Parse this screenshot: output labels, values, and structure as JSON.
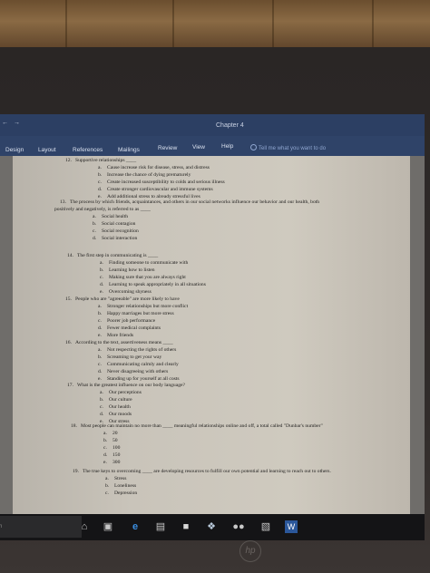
{
  "window": {
    "title": "Chapter 4",
    "quick_access": "← →"
  },
  "ribbon": {
    "tabs": [
      "Design",
      "Layout",
      "References",
      "Mailings",
      "Review",
      "View",
      "Help"
    ],
    "tell_me": "Tell me what you want to do"
  },
  "document": {
    "questions": [
      {
        "number": "12.",
        "text": "Supportive relationships ____",
        "options": [
          {
            "letter": "a.",
            "text": "Cause increase risk for disease, stress, and distress"
          },
          {
            "letter": "b.",
            "text": "Increase the chance of dying prematurely"
          },
          {
            "letter": "c.",
            "text": "Create increased susceptibility to colds and serious illness"
          },
          {
            "letter": "d.",
            "text": "Create stronger cardiovascular and immune systems"
          },
          {
            "letter": "e.",
            "text": "Add additional stress to already stressful lives"
          }
        ]
      },
      {
        "number": "13.",
        "text": "The process by which friends, acquaintances, and others in our social networks influence our behavior and our health, both",
        "text2": "positively and negatively, is referred to as ____",
        "options": [
          {
            "letter": "a.",
            "text": "Social health"
          },
          {
            "letter": "b.",
            "text": "Social contagion"
          },
          {
            "letter": "c.",
            "text": "Social recognition"
          },
          {
            "letter": "d.",
            "text": "Social interaction"
          }
        ]
      },
      {
        "number": "14.",
        "text": "The first step in communicating is ____",
        "options": [
          {
            "letter": "a.",
            "text": "Finding someone to communicate with"
          },
          {
            "letter": "b.",
            "text": "Learning how to listen"
          },
          {
            "letter": "c.",
            "text": "Making sure that you are always right"
          },
          {
            "letter": "d.",
            "text": "Learning to speak appropriately in all situations"
          },
          {
            "letter": "e.",
            "text": "Overcoming shyness"
          }
        ]
      },
      {
        "number": "15.",
        "text": "People who are \"agreeable\" are more likely to have",
        "options": [
          {
            "letter": "a.",
            "text": "Stronger relationships but more conflict"
          },
          {
            "letter": "b.",
            "text": "Happy marriages but more stress"
          },
          {
            "letter": "c.",
            "text": "Poorer job performance"
          },
          {
            "letter": "d.",
            "text": "Fewer medical complaints"
          },
          {
            "letter": "e.",
            "text": "More friends"
          }
        ]
      },
      {
        "number": "16.",
        "text": "According to the text, assertiveness means ____",
        "options": [
          {
            "letter": "a.",
            "text": "Not respecting the rights of others"
          },
          {
            "letter": "b.",
            "text": "Screaming to get your way"
          },
          {
            "letter": "c.",
            "text": "Communicating calmly and clearly"
          },
          {
            "letter": "d.",
            "text": "Never disagreeing with others"
          },
          {
            "letter": "e.",
            "text": "Standing up for yourself at all costs"
          }
        ]
      },
      {
        "number": "17.",
        "text": "What is the greatest influence on our body language?",
        "options": [
          {
            "letter": "a.",
            "text": "Our perceptions"
          },
          {
            "letter": "b.",
            "text": "Our culture"
          },
          {
            "letter": "c.",
            "text": "Our health"
          },
          {
            "letter": "d.",
            "text": "Our moods"
          },
          {
            "letter": "e.",
            "text": "Our stress"
          }
        ]
      },
      {
        "number": "18.",
        "text": "Most people can maintain no more than ____ meaningful relationships online and off, a total called \"Dunbar's number\"",
        "options": [
          {
            "letter": "a.",
            "text": "20"
          },
          {
            "letter": "b.",
            "text": "50"
          },
          {
            "letter": "c.",
            "text": "100"
          },
          {
            "letter": "d.",
            "text": "150"
          },
          {
            "letter": "e.",
            "text": "300"
          }
        ]
      },
      {
        "number": "19.",
        "text": "The true keys to overcoming ____ are developing resources to fulfill our own potential and learning to reach out to others.",
        "options": [
          {
            "letter": "a.",
            "text": "Stress"
          },
          {
            "letter": "b.",
            "text": "Loneliness"
          },
          {
            "letter": "c.",
            "text": "Depression"
          }
        ]
      }
    ]
  },
  "taskbar": {
    "search_fragment": "ch",
    "icons": [
      "microphone-icon",
      "task-view-icon",
      "edge-icon",
      "file-explorer-icon",
      "store-icon",
      "dropbox-icon",
      "flickr-icon",
      "photos-icon",
      "word-icon"
    ],
    "icon_glyphs": [
      "⌂",
      "▣",
      "e",
      "▤",
      "■",
      "❖",
      "●●",
      "▧",
      "W"
    ]
  },
  "device": {
    "logo": "hp"
  }
}
